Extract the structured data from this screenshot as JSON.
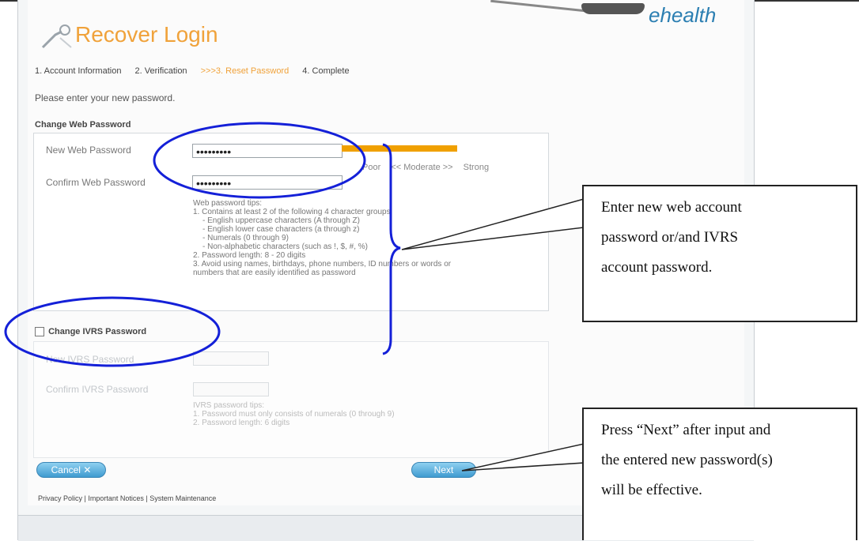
{
  "header": {
    "title": "Recover Login",
    "brand": "ehealth",
    "steps": [
      {
        "label": "1. Account Information",
        "active": false
      },
      {
        "label": "2. Verification",
        "active": false
      },
      {
        "label": ">>>3. Reset Password",
        "active": true
      },
      {
        "label": "4. Complete",
        "active": false
      }
    ]
  },
  "form": {
    "instruction": "Please enter your new password.",
    "web_section": {
      "heading": "Change Web Password",
      "new_label": "New Web Password",
      "new_value": "•••••••••",
      "confirm_label": "Confirm Web Password",
      "confirm_value": "•••••••••",
      "strength_labels": [
        "Poor",
        "<< Moderate >>",
        "Strong"
      ],
      "tips": [
        "Web password tips:",
        "1. Contains at least 2 of the following 4 character groups",
        "   - English uppercase characters (A through Z)",
        "   - English lower case characters (a through z)",
        "   - Numerals (0 through 9)",
        "   - Non-alphabetic characters (such as !, $, #, %)",
        "2. Password length: 8 - 20 digits",
        "3. Avoid using names, birthdays, phone numbers, ID numbers or words or",
        "numbers that are easily identified as password"
      ]
    },
    "ivrs_section": {
      "checkbox_label": "Change IVRS Password",
      "new_label": "New IVRS Password",
      "confirm_label": "Confirm IVRS Password",
      "tips": [
        "IVRS password tips:",
        "1. Password must only consists of numerals (0 through 9)",
        "2. Password length: 6 digits"
      ]
    },
    "cancel_label": "Cancel",
    "next_label": "Next"
  },
  "footer": {
    "links": "Privacy Policy | Important Notices | System Maintenance"
  },
  "annotations": {
    "callout1": [
      "Enter new web account",
      "password or/and IVRS",
      "account password."
    ],
    "callout2": [
      "Press “Next” after input and",
      "the entered new password(s)",
      "will be effective."
    ]
  }
}
